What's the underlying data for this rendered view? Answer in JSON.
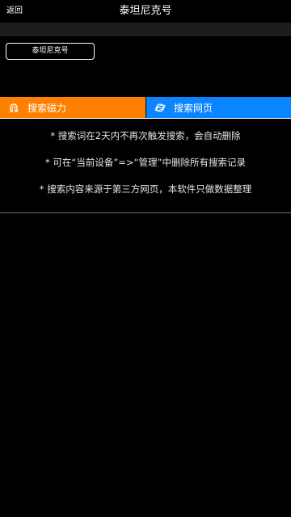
{
  "header": {
    "back_label": "返回",
    "title": "泰坦尼克号"
  },
  "query": {
    "chip_label": "泰坦尼克号"
  },
  "tabs": [
    {
      "label": "搜索磁力",
      "icon": "magnet-icon",
      "color": "#ff7f00"
    },
    {
      "label": "搜索网页",
      "icon": "globe-icon",
      "color": "#0a84ff"
    }
  ],
  "notes": [
    "* 搜索词在2天内不再次触发搜索，会自动删除",
    "* 可在“当前设备”=>“管理”中删除所有搜索记录",
    "* 搜索内容来源于第三方网页，本软件只做数据整理"
  ]
}
